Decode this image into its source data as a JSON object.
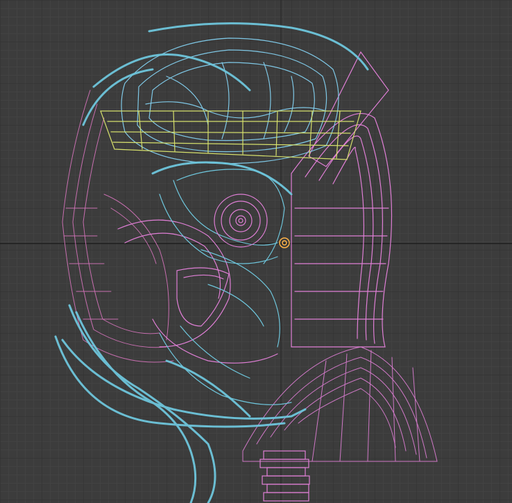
{
  "viewport": {
    "background": "#3c3c3c",
    "grid_minor_color": "#474747",
    "grid_major_color": "#2e2e2e",
    "axis_color": "#1f1f1f"
  },
  "model": {
    "icon": "wireframe-head-icon",
    "colors": {
      "shell": "#e07fd6",
      "cables": "#6ec6dc",
      "brain": "#7fc8e6",
      "band": "#d6e06c",
      "face": "#c86fb0",
      "gizmo": "#ffb347"
    }
  }
}
